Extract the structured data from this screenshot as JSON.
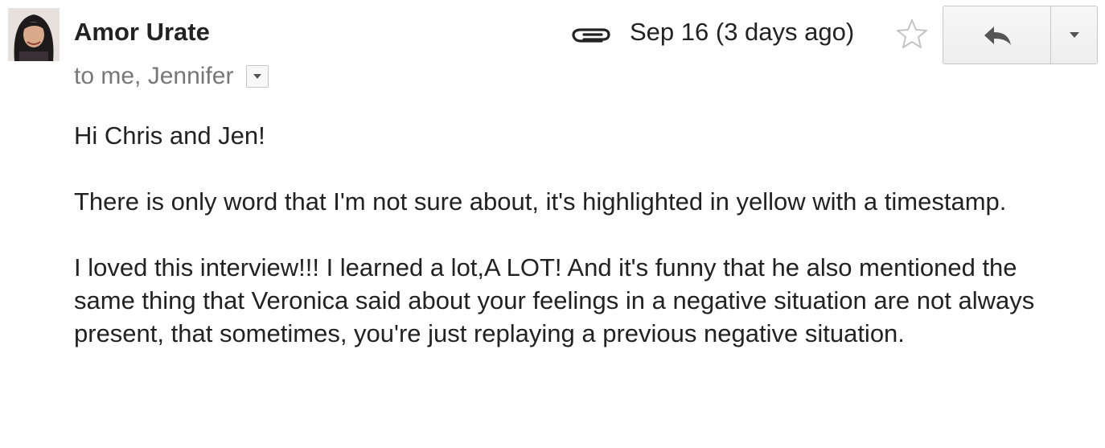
{
  "email": {
    "sender_name": "Amor Urate",
    "recipients": "to me, Jennifer",
    "date": "Sep 16 (3 days ago)",
    "has_attachment_icon": "paperclip-icon",
    "starred": false
  },
  "body": {
    "greeting": "Hi Chris and Jen!",
    "paragraph_1": "There is only word that I'm not sure about, it's highlighted in yellow with a timestamp.",
    "paragraph_2": "I loved this interview!!! I learned a lot,A LOT! And it's funny that he also mentioned the same thing that Veronica said about your feelings in a negative situation are not always present, that sometimes, you're just replaying a previous negative situation."
  },
  "colors": {
    "text": "#222222",
    "meta": "#777777",
    "button_border": "#c8c8c8"
  }
}
